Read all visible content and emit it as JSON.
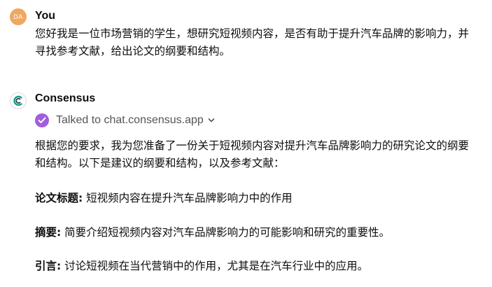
{
  "user_message": {
    "avatar_initials": "DA",
    "author": "You",
    "text": "您好我是一位市场营销的学生，想研究短视频内容，是否有助于提升汽车品牌的影响力，并寻找参考文献，给出论文的纲要和结构。"
  },
  "assistant_message": {
    "author": "Consensus",
    "tool_status": "Talked to chat.consensus.app",
    "intro": "根据您的要求，我为您准备了一份关于短视频内容对提升汽车品牌影响力的研究论文的纲要和结构。以下是建议的纲要和结构，以及参考文献：",
    "sections": [
      {
        "label": "论文标题",
        "separator": ":",
        "text": " 短视频内容在提升汽车品牌影响力中的作用"
      },
      {
        "label": "摘要",
        "separator": ":",
        "text": " 简要介绍短视频内容对汽车品牌影响力的可能影响和研究的重要性。"
      },
      {
        "label": "引言",
        "separator": ":",
        "text": " 讨论短视频在当代营销中的作用，尤其是在汽车行业中的应用。"
      }
    ]
  },
  "colors": {
    "user_avatar": "#f0a860",
    "tool_badge": "#a25ddc",
    "consensus_logo": "#1a9a8a"
  },
  "icons": {
    "assistant_avatar": "consensus-logo-icon",
    "tool_badge": "check-circle-icon",
    "tool_expand": "chevron-down-icon"
  }
}
